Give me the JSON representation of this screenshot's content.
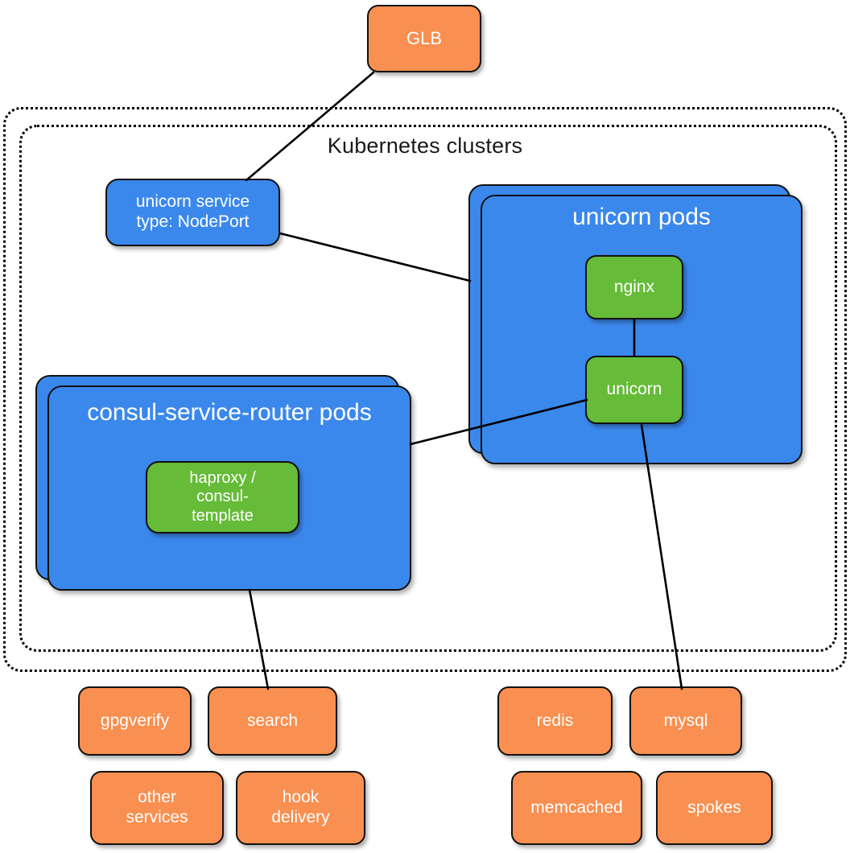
{
  "diagram": {
    "title": "Kubernetes clusters",
    "colors": {
      "orange": "#F98F50",
      "blue": "#3B88EC",
      "green": "#66BB38",
      "stroke": "#111111",
      "label_text": "#FFFFFF",
      "cluster_title_text": "#1A1A1A"
    }
  },
  "edge": {
    "glb": {
      "label": "GLB"
    }
  },
  "cluster": {
    "service": {
      "line1": "unicorn service",
      "line2": "type: NodePort",
      "text": "unicorn service\ntype: NodePort"
    },
    "unicorn_pods": {
      "title": "unicorn pods",
      "containers": [
        {
          "label": "nginx"
        },
        {
          "label": "unicorn"
        }
      ]
    },
    "consul_router_pods": {
      "title": "consul-service-router pods",
      "containers": [
        {
          "label": "haproxy /\nconsul-\ntemplate",
          "line1": "haproxy /",
          "line2": "consul-",
          "line3": "template"
        }
      ]
    }
  },
  "external_services": {
    "left": [
      {
        "label": "gpgverify"
      },
      {
        "label": "search"
      },
      {
        "label": "other\nservices",
        "line1": "other",
        "line2": "services"
      },
      {
        "label": "hook\ndelivery",
        "line1": "hook",
        "line2": "delivery"
      }
    ],
    "right": [
      {
        "label": "redis"
      },
      {
        "label": "mysql"
      },
      {
        "label": "memcached"
      },
      {
        "label": "spokes"
      }
    ]
  },
  "connections": [
    {
      "from": "GLB",
      "to": "unicorn service"
    },
    {
      "from": "unicorn service",
      "to": "unicorn pods"
    },
    {
      "from": "unicorn",
      "to": "consul-service-router pods"
    },
    {
      "from": "unicorn",
      "to": "mysql"
    },
    {
      "from": "nginx",
      "to": "unicorn"
    },
    {
      "from": "consul-service-router pods",
      "to": "search"
    }
  ]
}
